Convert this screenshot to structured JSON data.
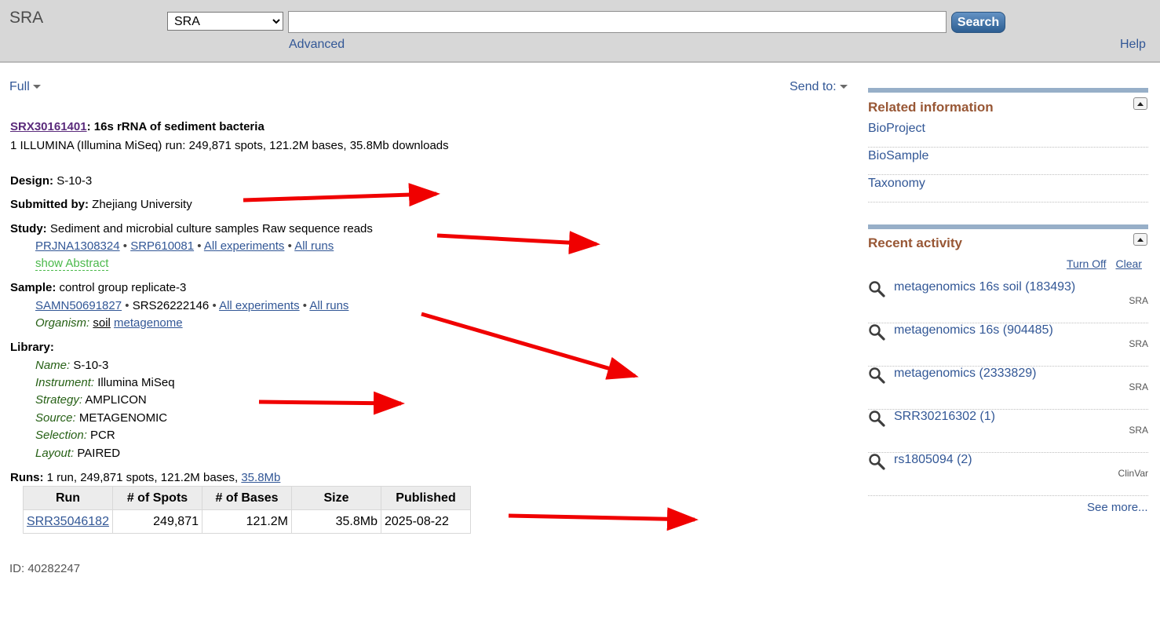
{
  "header": {
    "logo": "SRA",
    "db_selected": "SRA",
    "search_value": "",
    "search_button": "Search",
    "advanced": "Advanced",
    "help": "Help"
  },
  "toolbar": {
    "format": "Full",
    "send_to": "Send to:"
  },
  "record": {
    "accession": "SRX30161401",
    "title": "16s rRNA of sediment bacteria",
    "summary": "1 ILLUMINA (Illumina MiSeq) run: 249,871 spots, 121.2M bases, 35.8Mb downloads",
    "design_label": "Design:",
    "design": "S-10-3",
    "submitted_label": "Submitted by:",
    "submitted": "Zhejiang University",
    "study_label": "Study:",
    "study": "Sediment and microbial culture samples Raw sequence reads",
    "study_links": {
      "bioproject": "PRJNA1308324",
      "srp": "SRP610081",
      "all_experiments": "All experiments",
      "all_runs": "All runs"
    },
    "show_abstract": "show Abstract",
    "sample_label": "Sample:",
    "sample": "control group replicate-3",
    "sample_links": {
      "biosample": "SAMN50691827",
      "srs": "SRS26222146",
      "all_experiments": "All experiments",
      "all_runs": "All runs"
    },
    "organism_label": "Organism:",
    "organism_plain": "soil",
    "organism_link": "metagenome",
    "library_label": "Library:",
    "library": {
      "name_label": "Name:",
      "name": "S-10-3",
      "instrument_label": "Instrument:",
      "instrument": "Illumina MiSeq",
      "strategy_label": "Strategy:",
      "strategy": "AMPLICON",
      "source_label": "Source:",
      "source": "METAGENOMIC",
      "selection_label": "Selection:",
      "selection": "PCR",
      "layout_label": "Layout:",
      "layout": "PAIRED"
    },
    "runs_label": "Runs:",
    "runs_summary": "1 run, 249,871 spots, 121.2M bases,",
    "runs_size_link": "35.8Mb",
    "runs_table": {
      "headers": [
        "Run",
        "# of Spots",
        "# of Bases",
        "Size",
        "Published"
      ],
      "rows": [
        [
          "SRR35046182",
          "249,871",
          "121.2M",
          "35.8Mb",
          "2025-08-22"
        ]
      ]
    },
    "id_line": "ID: 40282247"
  },
  "sidebar": {
    "related": {
      "title": "Related information",
      "items": [
        "BioProject",
        "BioSample",
        "Taxonomy"
      ]
    },
    "recent": {
      "title": "Recent activity",
      "turn_off": "Turn Off",
      "clear": "Clear",
      "items": [
        {
          "text": "metagenomics 16s soil (183493)",
          "db": "SRA"
        },
        {
          "text": "metagenomics 16s (904485)",
          "db": "SRA"
        },
        {
          "text": "metagenomics (2333829)",
          "db": "SRA"
        },
        {
          "text": "SRR30216302 (1)",
          "db": "SRA"
        },
        {
          "text": "rs1805094 (2)",
          "db": "ClinVar"
        }
      ],
      "see_more": "See more..."
    }
  },
  "colors": {
    "link": "#325796",
    "arrow": "#f00000",
    "portlet_title": "#985735",
    "label_green": "#266015"
  },
  "icons": [
    "chevron-down-icon",
    "collapse-up-icon",
    "magnifier-icon",
    "annotation-arrow"
  ]
}
